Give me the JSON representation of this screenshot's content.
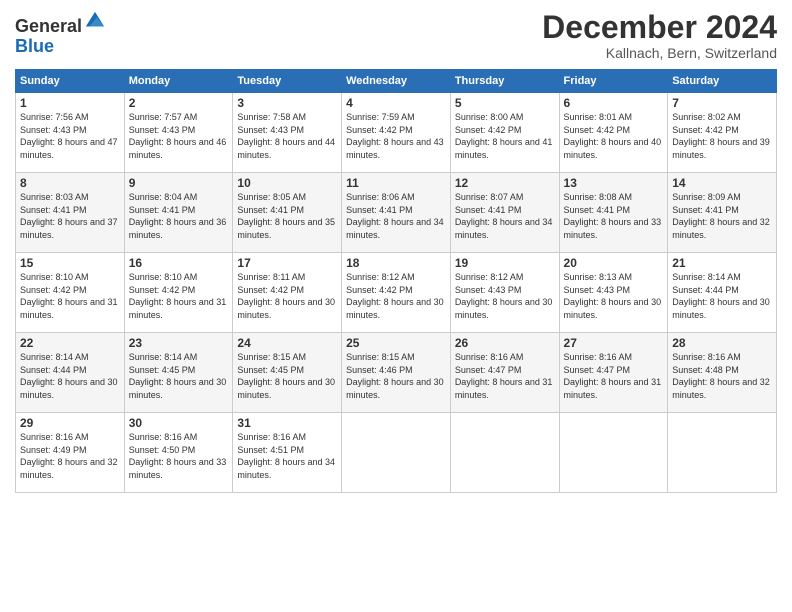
{
  "logo": {
    "general": "General",
    "blue": "Blue"
  },
  "header": {
    "month": "December 2024",
    "location": "Kallnach, Bern, Switzerland"
  },
  "weekdays": [
    "Sunday",
    "Monday",
    "Tuesday",
    "Wednesday",
    "Thursday",
    "Friday",
    "Saturday"
  ],
  "weeks": [
    [
      {
        "day": "1",
        "sunrise": "7:56 AM",
        "sunset": "4:43 PM",
        "daylight": "8 hours and 47 minutes."
      },
      {
        "day": "2",
        "sunrise": "7:57 AM",
        "sunset": "4:43 PM",
        "daylight": "8 hours and 46 minutes."
      },
      {
        "day": "3",
        "sunrise": "7:58 AM",
        "sunset": "4:43 PM",
        "daylight": "8 hours and 44 minutes."
      },
      {
        "day": "4",
        "sunrise": "7:59 AM",
        "sunset": "4:42 PM",
        "daylight": "8 hours and 43 minutes."
      },
      {
        "day": "5",
        "sunrise": "8:00 AM",
        "sunset": "4:42 PM",
        "daylight": "8 hours and 41 minutes."
      },
      {
        "day": "6",
        "sunrise": "8:01 AM",
        "sunset": "4:42 PM",
        "daylight": "8 hours and 40 minutes."
      },
      {
        "day": "7",
        "sunrise": "8:02 AM",
        "sunset": "4:42 PM",
        "daylight": "8 hours and 39 minutes."
      }
    ],
    [
      {
        "day": "8",
        "sunrise": "8:03 AM",
        "sunset": "4:41 PM",
        "daylight": "8 hours and 37 minutes."
      },
      {
        "day": "9",
        "sunrise": "8:04 AM",
        "sunset": "4:41 PM",
        "daylight": "8 hours and 36 minutes."
      },
      {
        "day": "10",
        "sunrise": "8:05 AM",
        "sunset": "4:41 PM",
        "daylight": "8 hours and 35 minutes."
      },
      {
        "day": "11",
        "sunrise": "8:06 AM",
        "sunset": "4:41 PM",
        "daylight": "8 hours and 34 minutes."
      },
      {
        "day": "12",
        "sunrise": "8:07 AM",
        "sunset": "4:41 PM",
        "daylight": "8 hours and 34 minutes."
      },
      {
        "day": "13",
        "sunrise": "8:08 AM",
        "sunset": "4:41 PM",
        "daylight": "8 hours and 33 minutes."
      },
      {
        "day": "14",
        "sunrise": "8:09 AM",
        "sunset": "4:41 PM",
        "daylight": "8 hours and 32 minutes."
      }
    ],
    [
      {
        "day": "15",
        "sunrise": "8:10 AM",
        "sunset": "4:42 PM",
        "daylight": "8 hours and 31 minutes."
      },
      {
        "day": "16",
        "sunrise": "8:10 AM",
        "sunset": "4:42 PM",
        "daylight": "8 hours and 31 minutes."
      },
      {
        "day": "17",
        "sunrise": "8:11 AM",
        "sunset": "4:42 PM",
        "daylight": "8 hours and 30 minutes."
      },
      {
        "day": "18",
        "sunrise": "8:12 AM",
        "sunset": "4:42 PM",
        "daylight": "8 hours and 30 minutes."
      },
      {
        "day": "19",
        "sunrise": "8:12 AM",
        "sunset": "4:43 PM",
        "daylight": "8 hours and 30 minutes."
      },
      {
        "day": "20",
        "sunrise": "8:13 AM",
        "sunset": "4:43 PM",
        "daylight": "8 hours and 30 minutes."
      },
      {
        "day": "21",
        "sunrise": "8:14 AM",
        "sunset": "4:44 PM",
        "daylight": "8 hours and 30 minutes."
      }
    ],
    [
      {
        "day": "22",
        "sunrise": "8:14 AM",
        "sunset": "4:44 PM",
        "daylight": "8 hours and 30 minutes."
      },
      {
        "day": "23",
        "sunrise": "8:14 AM",
        "sunset": "4:45 PM",
        "daylight": "8 hours and 30 minutes."
      },
      {
        "day": "24",
        "sunrise": "8:15 AM",
        "sunset": "4:45 PM",
        "daylight": "8 hours and 30 minutes."
      },
      {
        "day": "25",
        "sunrise": "8:15 AM",
        "sunset": "4:46 PM",
        "daylight": "8 hours and 30 minutes."
      },
      {
        "day": "26",
        "sunrise": "8:16 AM",
        "sunset": "4:47 PM",
        "daylight": "8 hours and 31 minutes."
      },
      {
        "day": "27",
        "sunrise": "8:16 AM",
        "sunset": "4:47 PM",
        "daylight": "8 hours and 31 minutes."
      },
      {
        "day": "28",
        "sunrise": "8:16 AM",
        "sunset": "4:48 PM",
        "daylight": "8 hours and 32 minutes."
      }
    ],
    [
      {
        "day": "29",
        "sunrise": "8:16 AM",
        "sunset": "4:49 PM",
        "daylight": "8 hours and 32 minutes."
      },
      {
        "day": "30",
        "sunrise": "8:16 AM",
        "sunset": "4:50 PM",
        "daylight": "8 hours and 33 minutes."
      },
      {
        "day": "31",
        "sunrise": "8:16 AM",
        "sunset": "4:51 PM",
        "daylight": "8 hours and 34 minutes."
      },
      null,
      null,
      null,
      null
    ]
  ],
  "labels": {
    "sunrise": "Sunrise:",
    "sunset": "Sunset:",
    "daylight": "Daylight:"
  }
}
